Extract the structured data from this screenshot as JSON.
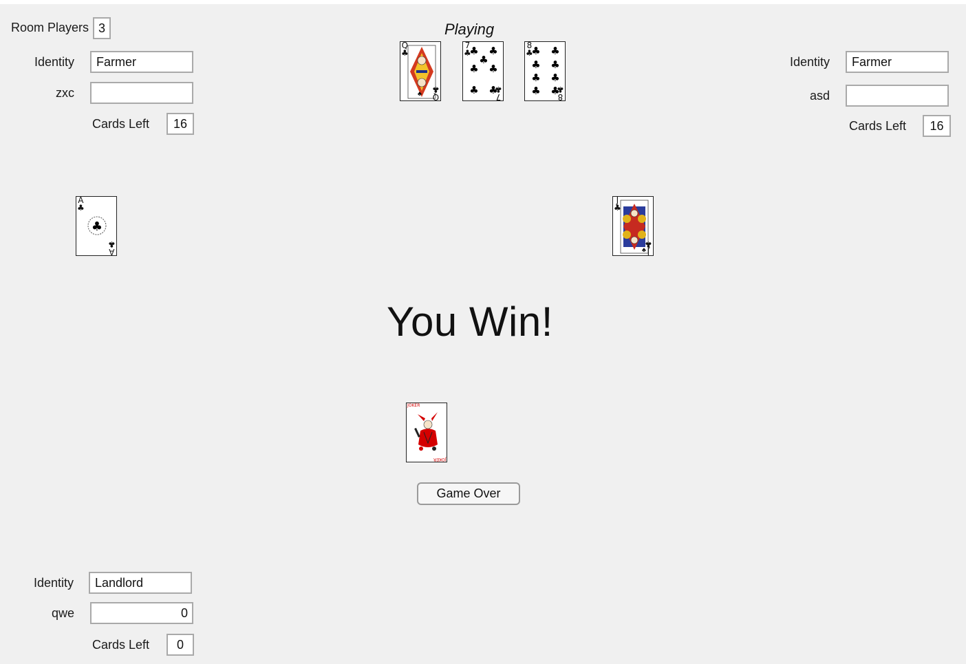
{
  "status_label": "Playing",
  "result_text": "You Win!",
  "game_over_button": "Game Over",
  "room": {
    "label": "Room Players",
    "count": "3"
  },
  "players": {
    "left": {
      "identity_label": "Identity",
      "identity": "Farmer",
      "name": "zxc",
      "score": "",
      "cards_left_label": "Cards Left",
      "cards_left": "16"
    },
    "right": {
      "identity_label": "Identity",
      "identity": "Farmer",
      "name": "asd",
      "score": "",
      "cards_left_label": "Cards Left",
      "cards_left": "16"
    },
    "bottom": {
      "identity_label": "Identity",
      "identity": "Landlord",
      "name": "qwe",
      "score": "0",
      "cards_left_label": "Cards Left",
      "cards_left": "0"
    }
  },
  "cards": {
    "landlord_cards": [
      {
        "rank": "Q",
        "suit": "♣"
      },
      {
        "rank": "7",
        "suit": "♣"
      },
      {
        "rank": "8",
        "suit": "♣"
      }
    ],
    "left_played": {
      "rank": "A",
      "suit": "♣"
    },
    "right_played": {
      "rank": "J",
      "suit": "♣"
    },
    "bottom_played": {
      "rank": "JOKER",
      "suit": ""
    }
  },
  "colors": {
    "background": "#f0f0f0",
    "field_border": "#a9a9a9",
    "joker_red": "#d40000"
  }
}
